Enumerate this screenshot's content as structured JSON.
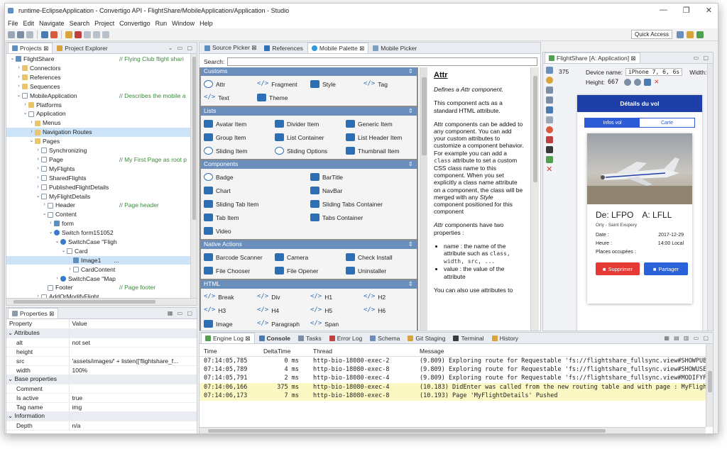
{
  "window": {
    "title": "runtime-EclipseApplication - Convertigo API - FlightShare/MobileApplication/Application - Studio",
    "controls": [
      "—",
      "❐",
      "✕"
    ]
  },
  "menu": [
    "File",
    "Edit",
    "Navigate",
    "Search",
    "Project",
    "Convertigo",
    "Run",
    "Window",
    "Help"
  ],
  "toolbar": {
    "quick_access": "Quick Access"
  },
  "left_tabs": [
    "Projects ⊠",
    "Project Explorer"
  ],
  "tree": [
    {
      "indent": 0,
      "arrow": "⌄",
      "icon": "proj",
      "label": "FlightShare",
      "comment": "// Flying Club flight shari"
    },
    {
      "indent": 1,
      "arrow": "›",
      "icon": "fold",
      "label": "Connectors"
    },
    {
      "indent": 1,
      "arrow": "›",
      "icon": "fold",
      "label": "References"
    },
    {
      "indent": 1,
      "arrow": "›",
      "icon": "fold",
      "label": "Sequences"
    },
    {
      "indent": 1,
      "arrow": "⌄",
      "icon": "page",
      "label": "MobileApplication",
      "comment": "// Describes the mobile a"
    },
    {
      "indent": 2,
      "arrow": "›",
      "icon": "fold",
      "label": "Platforms"
    },
    {
      "indent": 2,
      "arrow": "⌄",
      "icon": "page",
      "label": "Application"
    },
    {
      "indent": 3,
      "arrow": "›",
      "icon": "fold",
      "label": "Menus"
    },
    {
      "indent": 3,
      "arrow": "›",
      "icon": "fold",
      "label": "Navigation Routes",
      "selected": true
    },
    {
      "indent": 3,
      "arrow": "⌄",
      "icon": "fold",
      "label": "Pages"
    },
    {
      "indent": 4,
      "arrow": "›",
      "icon": "page",
      "label": "Synchronizing"
    },
    {
      "indent": 4,
      "arrow": "›",
      "icon": "page",
      "label": "Page",
      "comment": "// My First Page as root p"
    },
    {
      "indent": 4,
      "arrow": "›",
      "icon": "page",
      "label": "MyFlights"
    },
    {
      "indent": 4,
      "arrow": "›",
      "icon": "page",
      "label": "SharedFlights"
    },
    {
      "indent": 4,
      "arrow": "›",
      "icon": "page",
      "label": "PublishedFlightDetails"
    },
    {
      "indent": 4,
      "arrow": "⌄",
      "icon": "page",
      "label": "MyFlightDetails"
    },
    {
      "indent": 5,
      "arrow": "›",
      "icon": "page",
      "label": "Header",
      "comment": "// Page header"
    },
    {
      "indent": 5,
      "arrow": "⌄",
      "icon": "page",
      "label": "Content"
    },
    {
      "indent": 6,
      "arrow": "›",
      "icon": "proj",
      "label": "form"
    },
    {
      "indent": 6,
      "arrow": "⌄",
      "icon": "comp",
      "label": "Switch form151052"
    },
    {
      "indent": 7,
      "arrow": "⌄",
      "icon": "comp",
      "label": "SwitchCase \"Fligh"
    },
    {
      "indent": 8,
      "arrow": "⌄",
      "icon": "page",
      "label": "Card"
    },
    {
      "indent": 9,
      "arrow": "",
      "icon": "proj",
      "label": "Image1",
      "extra": "...",
      "selected": true
    },
    {
      "indent": 9,
      "arrow": "›",
      "icon": "page",
      "label": "CardContent"
    },
    {
      "indent": 7,
      "arrow": "›",
      "icon": "comp",
      "label": "SwitchCase \"Map"
    },
    {
      "indent": 5,
      "arrow": "",
      "icon": "page",
      "label": "Footer",
      "comment": "// Page footer"
    },
    {
      "indent": 4,
      "arrow": "›",
      "icon": "page",
      "label": "AddOrModifyFlight"
    }
  ],
  "properties": {
    "tab": "Properties ⊠",
    "header": [
      "Property",
      "Value"
    ],
    "rows": [
      {
        "group": true,
        "k": "⌄ Attributes",
        "v": ""
      },
      {
        "k": "alt",
        "v": "not set"
      },
      {
        "k": "height",
        "v": ""
      },
      {
        "k": "src",
        "v": "'assets/images/' + listen(['flightshare_f..."
      },
      {
        "k": "width",
        "v": "100%"
      },
      {
        "group": true,
        "k": "⌄ Base properties",
        "v": ""
      },
      {
        "k": "Comment",
        "v": ""
      },
      {
        "k": "Is active",
        "v": "true"
      },
      {
        "k": "Tag name",
        "v": "img"
      },
      {
        "group": true,
        "k": "⌄ Information",
        "v": ""
      },
      {
        "k": "Depth",
        "v": "n/a"
      }
    ]
  },
  "palette": {
    "tabs": [
      "Source Picker ⊠",
      "References",
      "Mobile Palette ⊠",
      "Mobile Picker"
    ],
    "search_label": "Search:",
    "sections": [
      {
        "title": "Customs",
        "cols": 4,
        "items": [
          [
            "Attr",
            "c"
          ],
          [
            "Fragment",
            "t"
          ],
          [
            "Style",
            "s"
          ],
          [
            "Tag",
            "t"
          ],
          [
            "Text",
            "t"
          ],
          [
            "Theme",
            "s"
          ]
        ]
      },
      {
        "title": "Lists",
        "cols": 3,
        "items": [
          [
            "Avatar Item",
            "s"
          ],
          [
            "Divider Item",
            "s"
          ],
          [
            "Generic Item",
            "s"
          ],
          [
            "Group Item",
            "s"
          ],
          [
            "List Container",
            "s"
          ],
          [
            "List Header Item",
            "s"
          ],
          [
            "Sliding Item",
            "c"
          ],
          [
            "Sliding Options",
            "c"
          ],
          [
            "Thumbnail Item",
            "s"
          ]
        ]
      },
      {
        "title": "Components",
        "cols": 2,
        "items": [
          [
            "Badge",
            "c"
          ],
          [
            "BarTitle",
            "s"
          ],
          [
            "Chart",
            "s"
          ],
          [
            "NavBar",
            "s"
          ],
          [
            "Sliding Tab Item",
            "s"
          ],
          [
            "Sliding Tabs Container",
            "s"
          ],
          [
            "Tab Item",
            "s"
          ],
          [
            "Tabs Container",
            "s"
          ],
          [
            "Video",
            "s"
          ]
        ]
      },
      {
        "title": "Native Actions",
        "cols": 3,
        "items": [
          [
            "Barcode Scanner",
            "s"
          ],
          [
            "Camera",
            "s"
          ],
          [
            "Check Install",
            "s"
          ],
          [
            "File Chooser",
            "s"
          ],
          [
            "File Opener",
            "s"
          ],
          [
            "Uninstaller",
            "s"
          ]
        ]
      },
      {
        "title": "HTML",
        "cols": 4,
        "items": [
          [
            "Break",
            "t"
          ],
          [
            "Div",
            "t"
          ],
          [
            "H1",
            "t"
          ],
          [
            "H2",
            "t"
          ],
          [
            "H3",
            "t"
          ],
          [
            "H4",
            "t"
          ],
          [
            "H5",
            "t"
          ],
          [
            "H6",
            "t"
          ],
          [
            "Image",
            "s"
          ],
          [
            "Paragraph",
            "t"
          ],
          [
            "Span",
            "t"
          ]
        ]
      }
    ]
  },
  "doc": {
    "title": "Attr",
    "intro": "Defines a Attr component.",
    "p1": "This component acts as a standard HTML attribute.",
    "p2a": "Attr components can be added to any component. You can add your custom attributes to customize a component behavior. For example you can add a ",
    "p2code": "class",
    "p2b": " attribute to set a custom CSS class name to this component. When you set explicitly a class name attribute on a component, the class will be merged with any ",
    "p2em": "Style",
    "p2c": " component positioned for this component",
    "p3a": "Attr",
    "p3b": " components have two properties :",
    "li1a": "name : the name of the attribute such as ",
    "li1code": "class, width, src, ...",
    "li2": "value : the value of the attribute",
    "p4": "You can also use attributes to"
  },
  "console": {
    "tabs": [
      "Engine Log ⊠",
      "Console",
      "Tasks",
      "Error Log",
      "Schema",
      "Git Staging",
      "Terminal",
      "History"
    ],
    "headers": [
      "Time",
      "DeltaTime",
      "Thread",
      "Message"
    ],
    "rows": [
      {
        "time": "07:14:05,785",
        "delta": "0 ms",
        "thread": "http-bio-18080-exec-2",
        "msg": "(9.809) Exploring route for Requestable 'fs://flightshare_fullsync.view#SHOWPUBL",
        "hl": false
      },
      {
        "time": "07:14:05,789",
        "delta": "4 ms",
        "thread": "http-bio-18080-exec-8",
        "msg": "(9.809) Exploring route for Requestable 'fs://flightshare_fullsync.view#SHOWUSER",
        "hl": false
      },
      {
        "time": "07:14:05,791",
        "delta": "2 ms",
        "thread": "http-bio-18080-exec-4",
        "msg": "(9.809) Exploring route for Requestable 'fs://flightshare_fullsync.view#MODIFYFL",
        "hl": false
      },
      {
        "time": "07:14:06,166",
        "delta": "375 ms",
        "thread": "http-bio-18080-exec-4",
        "msg": "(10.183) DidEnter was called from the new routing table and with page : MyFlight",
        "hl": true
      },
      {
        "time": "07:14:06,173",
        "delta": "7 ms",
        "thread": "http-bio-18080-exec-8",
        "msg": "(10.193) Page 'MyFlightDetails' Pushed",
        "hl": true
      }
    ]
  },
  "mobile": {
    "tab": "FlightShare [A: Application] ⊠",
    "device_label": "Device name:",
    "device": "iPhone 7, 6, 6s",
    "width_label": "Width:",
    "width": "375",
    "height_label": "Height:",
    "height": "667",
    "header": "Détails du vol",
    "tab_info": "Infos vol",
    "tab_map": "Carte",
    "dep": "De: LFPO",
    "arr": "A: LFLL",
    "airport": "Orly - Saint Exupery",
    "date_label": "Date :",
    "date": "2017-12-29",
    "hour_label": "Heure :",
    "hour": "14:00 Local",
    "seats_label": "Places occupées :",
    "btn_delete": "Supprimer",
    "btn_share": "Partager"
  },
  "colors": {
    "accent": "#2d6fb5",
    "section_header": "#6a8fbd",
    "phone_header": "#1f3fa8",
    "delete": "#e53935",
    "share": "#2962d9",
    "selection": "#cde3f7"
  }
}
